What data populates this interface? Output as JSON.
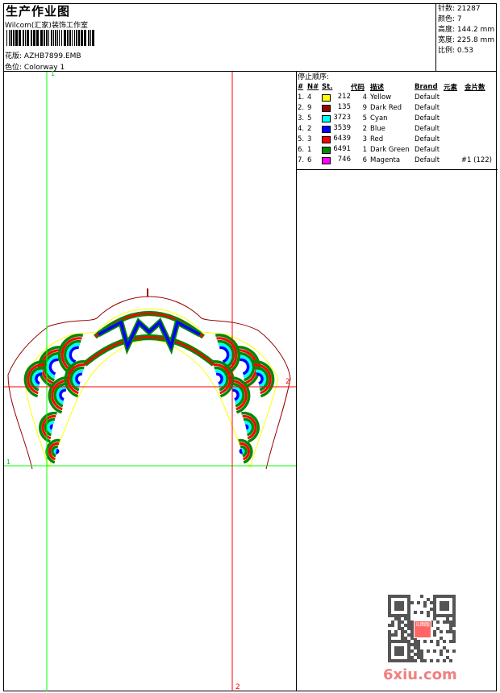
{
  "header": {
    "title": "生产作业图",
    "company": "Wilcom(汇家)装饰工作室",
    "design_label": "花版:",
    "design_value": "AZHB7899.EMB",
    "colorway_label": "色位:",
    "colorway_value": "Colorway 1"
  },
  "stats": [
    {
      "label": "针数:",
      "value": "21287"
    },
    {
      "label": "颜色:",
      "value": "7"
    },
    {
      "label": "高度:",
      "value": "144.2 mm"
    },
    {
      "label": "宽度:",
      "value": "225.8 mm"
    },
    {
      "label": "比例:",
      "value": "0.53"
    }
  ],
  "stop_sequence": {
    "title": "停止顺序:",
    "columns": [
      "#",
      "N#",
      "St.",
      "代码",
      "描述",
      "Brand",
      "元素",
      "金片数"
    ],
    "rows": [
      {
        "idx": "1.",
        "n": "4",
        "color": "#ffff00",
        "st": "212",
        "code": "4",
        "desc": "Yellow",
        "brand": "Default",
        "extra": ""
      },
      {
        "idx": "2.",
        "n": "9",
        "color": "#990000",
        "st": "135",
        "code": "9",
        "desc": "Dark Red",
        "brand": "Default",
        "extra": ""
      },
      {
        "idx": "3.",
        "n": "5",
        "color": "#00ffff",
        "st": "3723",
        "code": "5",
        "desc": "Cyan",
        "brand": "Default",
        "extra": ""
      },
      {
        "idx": "4.",
        "n": "2",
        "color": "#0000ff",
        "st": "3539",
        "code": "2",
        "desc": "Blue",
        "brand": "Default",
        "extra": ""
      },
      {
        "idx": "5.",
        "n": "3",
        "color": "#ff0000",
        "st": "6439",
        "code": "3",
        "desc": "Red",
        "brand": "Default",
        "extra": ""
      },
      {
        "idx": "6.",
        "n": "1",
        "color": "#008800",
        "st": "6491",
        "code": "1",
        "desc": "Dark Green",
        "brand": "Default",
        "extra": ""
      },
      {
        "idx": "7.",
        "n": "6",
        "color": "#ff00ff",
        "st": "746",
        "code": "6",
        "desc": "Magenta",
        "brand": "Default",
        "extra": "#1 (122)"
      }
    ]
  },
  "guides": {
    "green_label_v": "1",
    "green_label_h": "1",
    "red_label_v": "2",
    "red_label_h": "2"
  },
  "watermark": {
    "site": "6xiu.com",
    "seal": "以图版"
  }
}
